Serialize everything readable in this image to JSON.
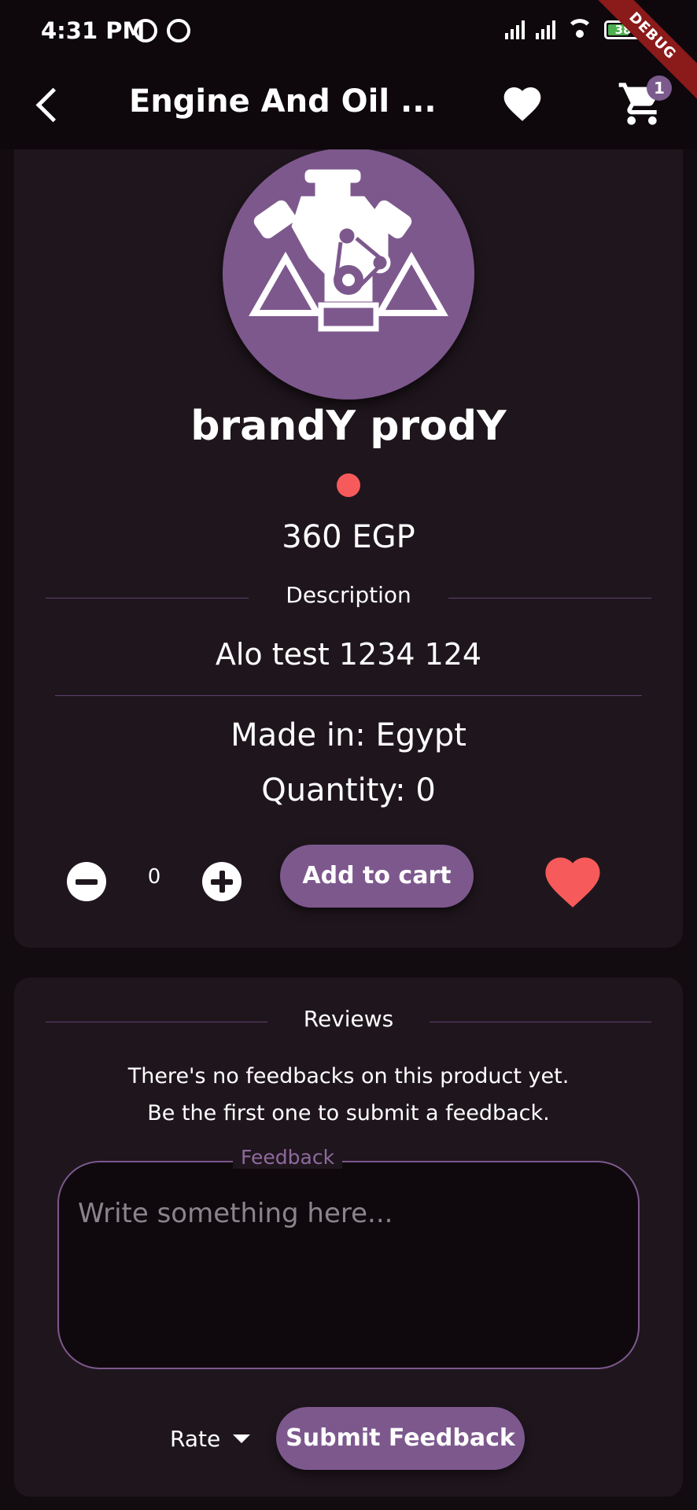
{
  "status_bar": {
    "time": "4:31 PM",
    "battery": "38"
  },
  "debug_ribbon": "DEBUG",
  "app_bar": {
    "title": "Engine And Oil ...",
    "cart_count": "1"
  },
  "product": {
    "name": "brandY prodY",
    "status_color": "#f75a5a",
    "price": "360 EGP",
    "description_label": "Description",
    "description": "Alo test 1234 124",
    "made_in": "Made in: Egypt",
    "quantity": "Quantity: 0",
    "selected_quantity": "0",
    "add_to_cart_label": "Add to cart"
  },
  "reviews": {
    "section_label": "Reviews",
    "empty_line1": "There's no feedbacks on this product yet.",
    "empty_line2": "Be the first one to submit a feedback.",
    "feedback_label": "Feedback",
    "feedback_placeholder": "Write something here...",
    "rate_label": "Rate",
    "submit_label": "Submit Feedback"
  },
  "colors": {
    "accent": "#7d588d",
    "card_background": "#1f161d",
    "page_background": "#120c11",
    "heart": "#f75a5a"
  }
}
